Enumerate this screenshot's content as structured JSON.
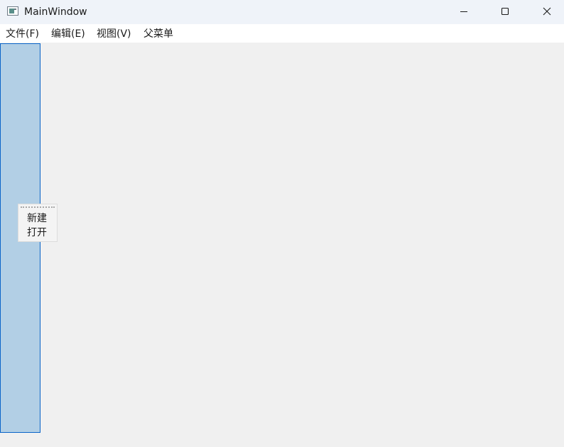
{
  "window": {
    "title": "MainWindow",
    "icon": "app-window-icon"
  },
  "title_buttons": {
    "minimize": "minimize-icon",
    "maximize": "maximize-icon",
    "close": "close-icon"
  },
  "menubar": {
    "items": [
      {
        "label": "文件(F)"
      },
      {
        "label": "编辑(E)"
      },
      {
        "label": "视图(V)"
      },
      {
        "label": "父菜单"
      }
    ]
  },
  "toolbar": {
    "actions": [
      {
        "label": "新建"
      },
      {
        "label": "打开"
      }
    ]
  },
  "colors": {
    "titlebar_bg": "#eff3f9",
    "menubar_bg": "#ffffff",
    "client_bg": "#f0f0f0",
    "dock_highlight": "#b2cfe5",
    "dock_border": "#0a64c8"
  }
}
